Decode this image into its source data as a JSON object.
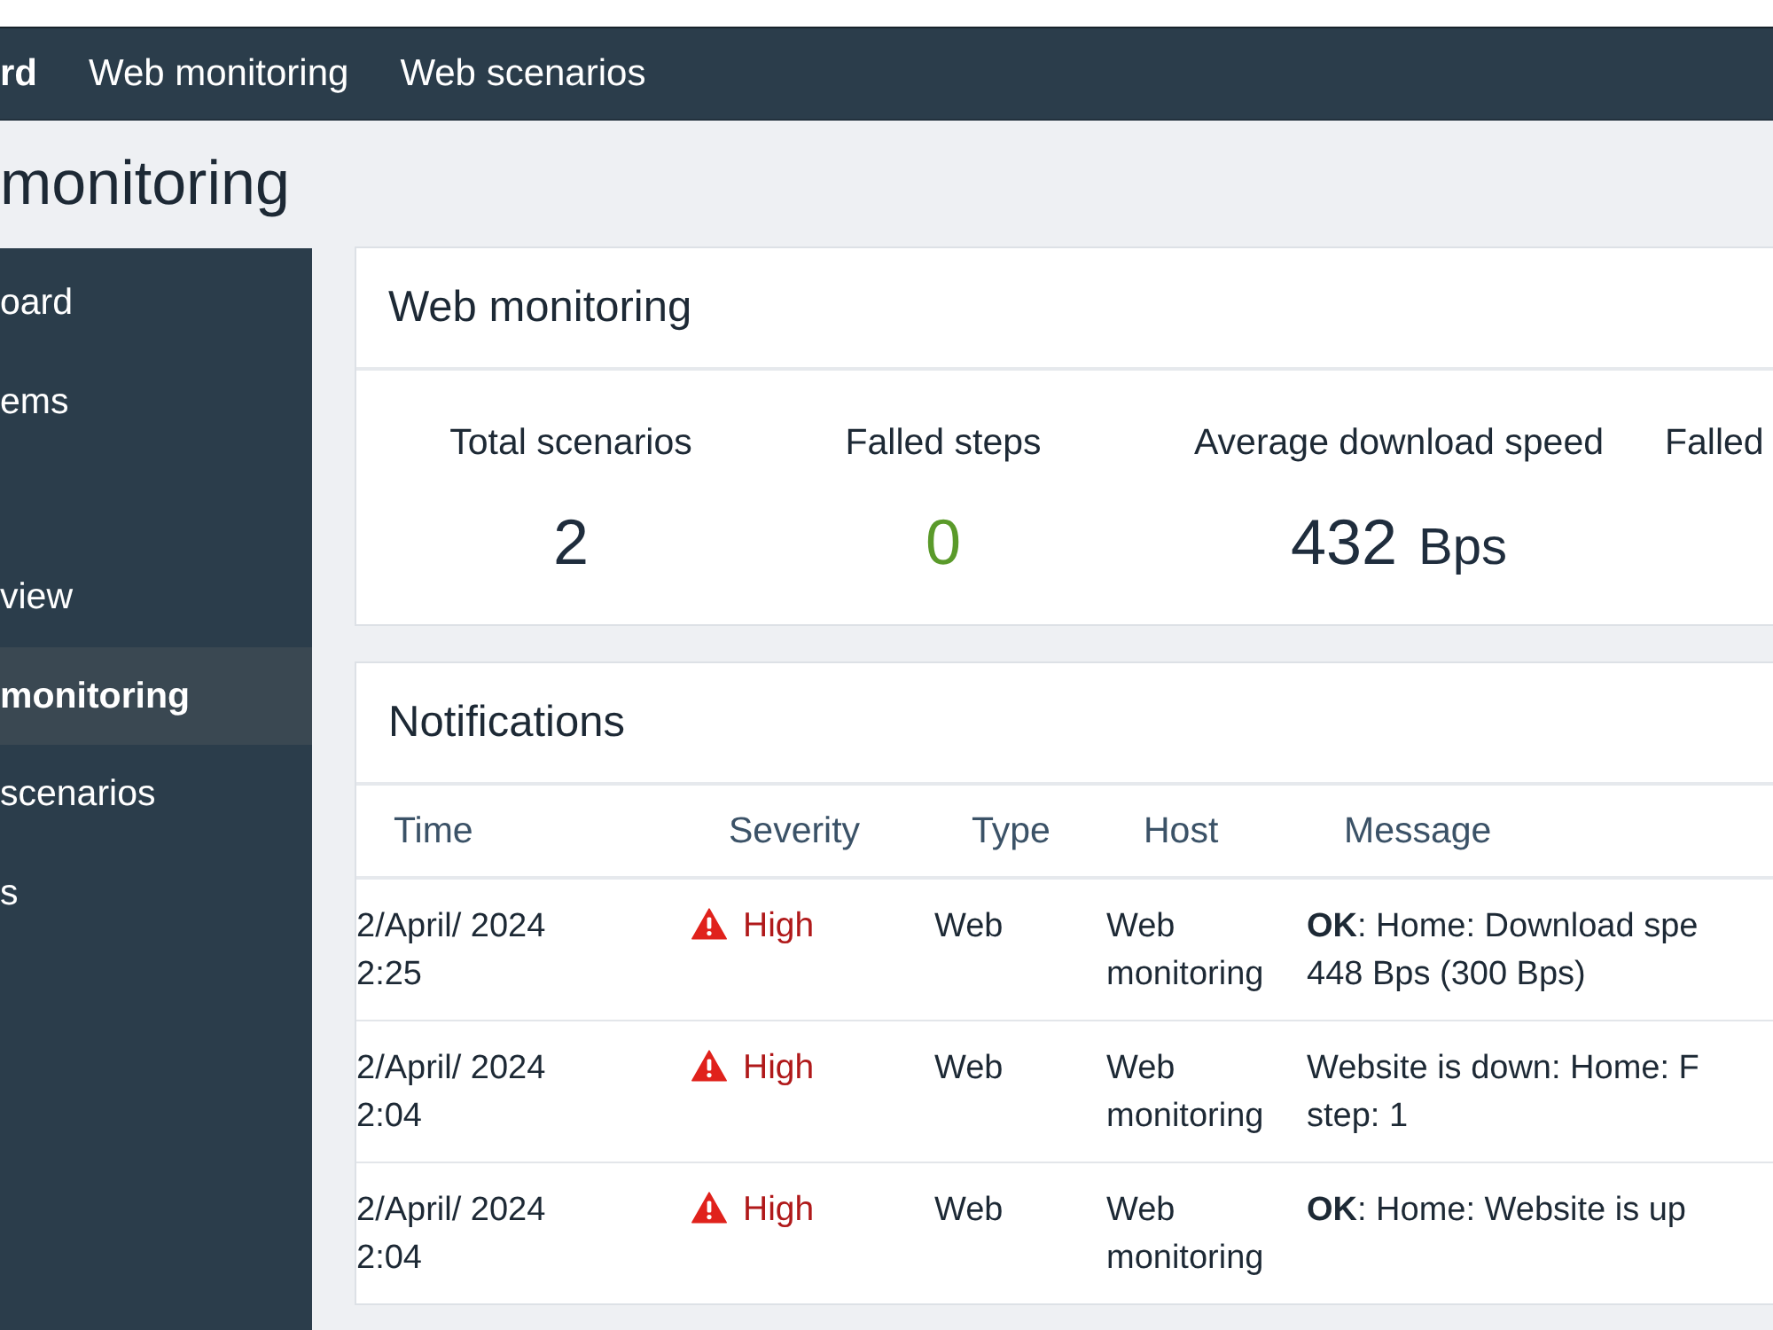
{
  "top_nav": {
    "items": [
      {
        "label": "rd",
        "selected": true
      },
      {
        "label": "Web monitoring",
        "selected": false
      },
      {
        "label": "Web scenarios",
        "selected": false
      }
    ]
  },
  "page_title": "monitoring",
  "sidebar": {
    "groups": [
      {
        "items": [
          {
            "label": "oard",
            "selected": false
          },
          {
            "label": "ems",
            "selected": false
          }
        ]
      },
      {
        "items": [
          {
            "label": "view",
            "selected": false
          },
          {
            "label": "monitoring",
            "selected": true
          },
          {
            "label": "scenarios",
            "selected": false
          },
          {
            "label": "s",
            "selected": false
          }
        ]
      }
    ]
  },
  "summary_panel": {
    "title": "Web monitoring",
    "stats": [
      {
        "label": "Total scenarios",
        "value": "2",
        "color": "#1f2d3d"
      },
      {
        "label": "Falled steps",
        "value": "0",
        "color": "#5a9a2a"
      },
      {
        "label": "Average download speed",
        "value": "432",
        "unit": "Bps",
        "color": "#1f2d3d"
      },
      {
        "label": "Falled"
      }
    ]
  },
  "notifications": {
    "title": "Notifications",
    "table": {
      "columns": [
        "Time",
        "Severity",
        "Type",
        "Host",
        "Message"
      ],
      "rows": [
        {
          "time": "2/April/ 2024\n2:25",
          "severity": {
            "kind": "high",
            "label": "High"
          },
          "type": "Web",
          "host": "Web monitoring",
          "message": "**OK**: Home: Download spe\n448 Bps (300 Bps)"
        },
        {
          "time": "2/April/ 2024\n2:04",
          "severity": {
            "kind": "high",
            "label": "High"
          },
          "type": "Web",
          "host": "Web monitoring",
          "message": "Website is down: Home: F\nstep: 1"
        },
        {
          "time": "2/April/ 2024\n2:04",
          "severity": {
            "kind": "high",
            "label": "High"
          },
          "type": "Web",
          "host": "Web monitoring",
          "message": "**OK**: Home: Website is up"
        }
      ]
    }
  }
}
